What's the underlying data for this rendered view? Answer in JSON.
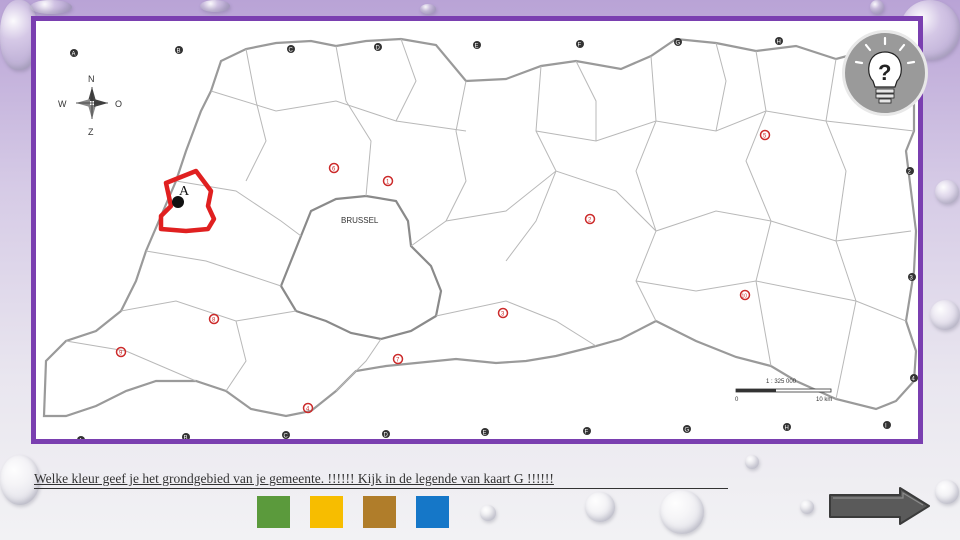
{
  "map": {
    "compass": {
      "north": "N",
      "south": "Z",
      "west": "W",
      "east": "O"
    },
    "marker_label": "A",
    "city_label": "BRUSSEL",
    "scale_text": "1 : 325 000",
    "scale_start": "0",
    "scale_end": "10 km",
    "top_letters": [
      "A",
      "B",
      "C",
      "D",
      "E",
      "F",
      "G",
      "H"
    ],
    "bottom_letters": [
      "A",
      "B",
      "C",
      "D",
      "E",
      "F",
      "G",
      "H",
      "I"
    ],
    "right_numbers": [
      "2",
      "3",
      "4",
      "5"
    ],
    "numbered_labels": [
      "1",
      "2",
      "3",
      "4",
      "5",
      "6",
      "7",
      "8",
      "9",
      "10"
    ]
  },
  "help": {
    "icon": "lightbulb-question-icon",
    "label": "?"
  },
  "question": "Welke kleur geef je het grondgebied van je gemeente. !!!!!! Kijk in de legende van kaart G !!!!!!",
  "color_choices": [
    {
      "name": "green",
      "color": "#5b9a3c"
    },
    {
      "name": "yellow",
      "color": "#f7bd00"
    },
    {
      "name": "brown",
      "color": "#b07d2a"
    },
    {
      "name": "blue",
      "color": "#1577c8"
    }
  ],
  "next": {
    "icon": "arrow-right-icon"
  },
  "colors": {
    "frame": "#7a3fb0",
    "highlight": "#e02020",
    "map_label": "#cc2b2b"
  }
}
